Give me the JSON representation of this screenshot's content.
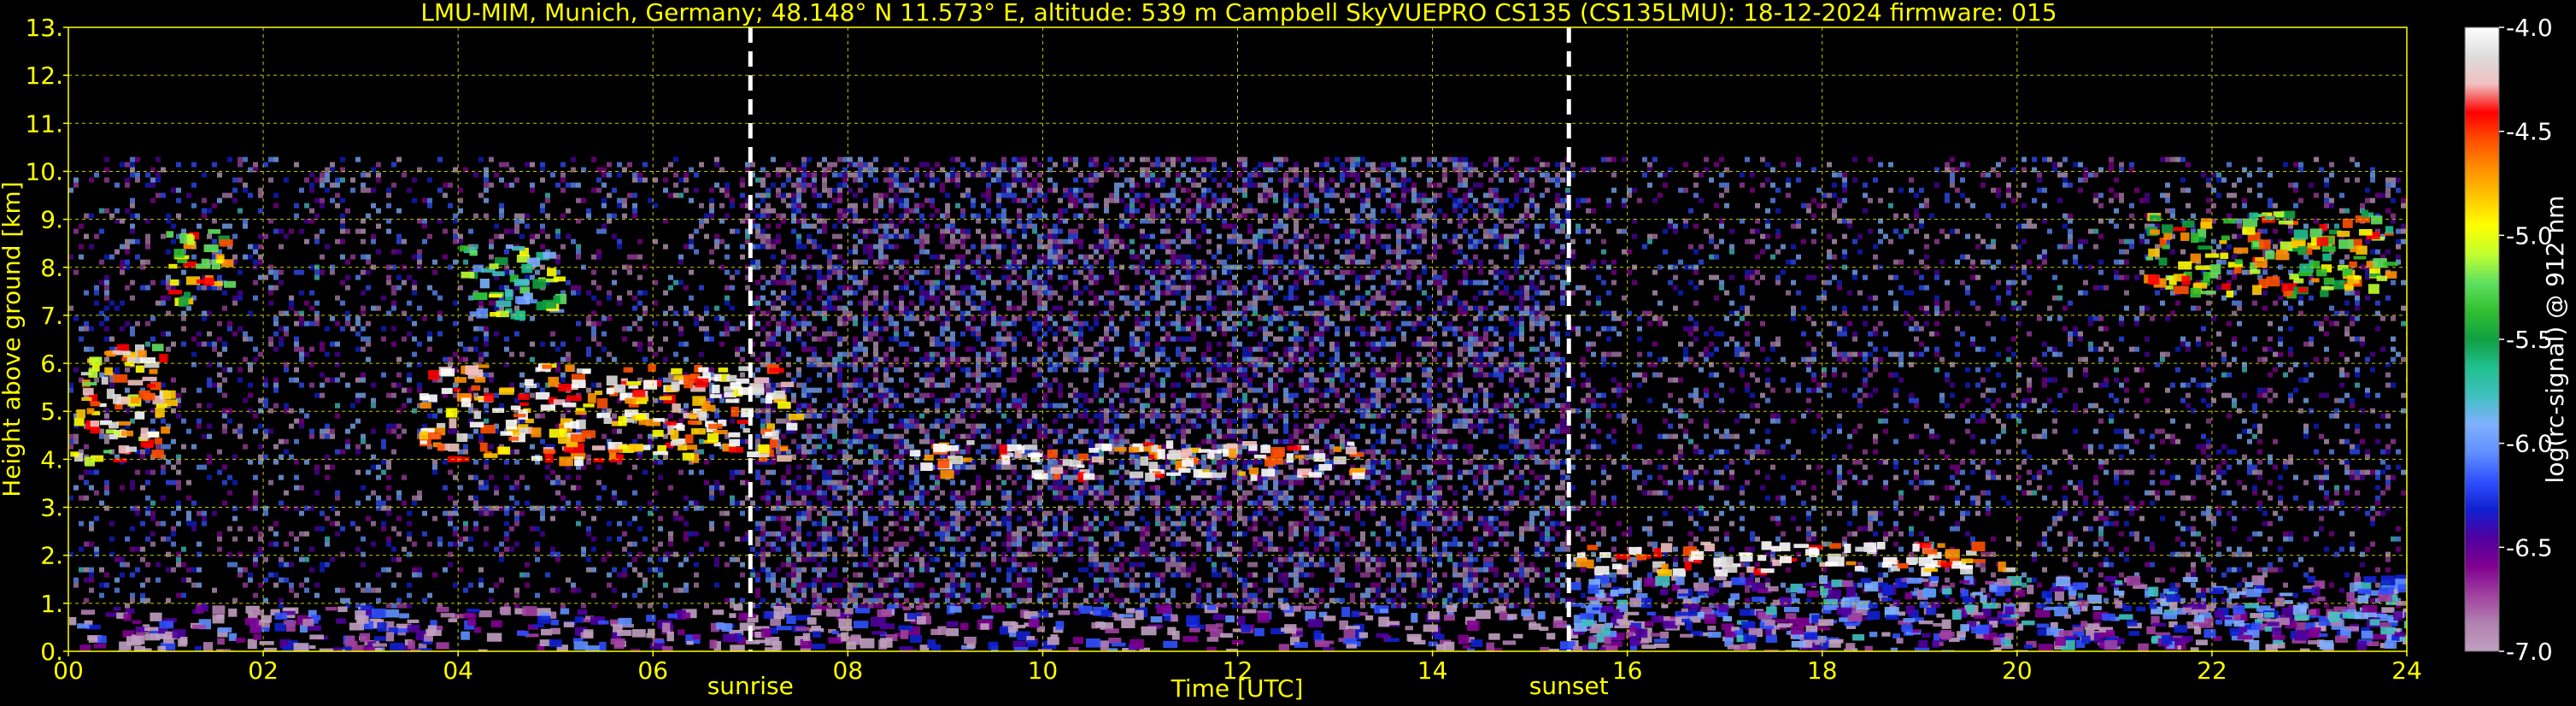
{
  "chart_data": {
    "type": "heatmap",
    "title": "LMU-MIM, Munich, Germany; 48.148° N 11.573° E, altitude: 539 m    Campbell SkyVUEPRO CS135 (CS135LMU): 18-12-2024    firmware: 015",
    "xlabel": "Time [UTC]",
    "ylabel": "Height above ground [km]",
    "xlim": [
      0,
      24
    ],
    "ylim": [
      0,
      13
    ],
    "x_ticks": [
      "00",
      "02",
      "04",
      "06",
      "08",
      "10",
      "12",
      "14",
      "16",
      "18",
      "20",
      "22",
      "24"
    ],
    "y_ticks": [
      "0.",
      "1.",
      "2.",
      "3.",
      "4.",
      "5.",
      "6.",
      "7.",
      "8.",
      "9.",
      "10.",
      "11.",
      "12.",
      "13."
    ],
    "grid": true,
    "events": [
      {
        "label": "sunrise",
        "x": 7.0
      },
      {
        "label": "sunset",
        "x": 15.4
      }
    ],
    "signal_top_km": 10.3,
    "colorbar": {
      "label": "log(rc-signal) @ 912 nm",
      "range": [
        -7.0,
        -4.0
      ],
      "ticks": [
        "-4.0",
        "-4.5",
        "-5.0",
        "-5.5",
        "-6.0",
        "-6.5",
        "-7.0"
      ],
      "colors": [
        "#ffffff",
        "#dddddd",
        "#f0c0c0",
        "#ff0000",
        "#ff5000",
        "#ff9000",
        "#ffc800",
        "#ffff00",
        "#c0ff30",
        "#60e060",
        "#30c030",
        "#10a040",
        "#20c090",
        "#40c0c0",
        "#80b0ff",
        "#6090ff",
        "#3050ff",
        "#1020d0",
        "#5000a0",
        "#800090",
        "#a040a0",
        "#b080b0",
        "#c0a0c0"
      ]
    },
    "features": [
      {
        "name": "cloud layer",
        "x": [
          0.0,
          1.0
        ],
        "y": [
          4.0,
          6.5
        ],
        "intensity": -4.6
      },
      {
        "name": "cloud layer",
        "x": [
          1.0,
          1.6
        ],
        "y": [
          7.2,
          8.8
        ],
        "intensity": -5.0
      },
      {
        "name": "cloud layer",
        "x": [
          3.6,
          7.4
        ],
        "y": [
          4.0,
          6.0
        ],
        "intensity": -4.4
      },
      {
        "name": "cloud layer",
        "x": [
          4.0,
          5.0
        ],
        "y": [
          7.0,
          8.5
        ],
        "intensity": -5.5
      },
      {
        "name": "cloud layer",
        "x": [
          8.6,
          13.2
        ],
        "y": [
          3.7,
          4.4
        ],
        "intensity": -4.2
      },
      {
        "name": "cloud layer",
        "x": [
          15.4,
          19.9
        ],
        "y": [
          1.7,
          2.3
        ],
        "intensity": -4.2
      },
      {
        "name": "cloud layer",
        "x": [
          21.3,
          23.8
        ],
        "y": [
          7.5,
          9.2
        ],
        "intensity": -5.0
      },
      {
        "name": "boundary layer aerosol",
        "x": [
          0.0,
          24.0
        ],
        "y": [
          0.0,
          1.0
        ],
        "intensity": -6.6
      },
      {
        "name": "boundary layer aerosol",
        "x": [
          15.4,
          24.0
        ],
        "y": [
          0.2,
          1.6
        ],
        "intensity": -6.3
      }
    ]
  }
}
